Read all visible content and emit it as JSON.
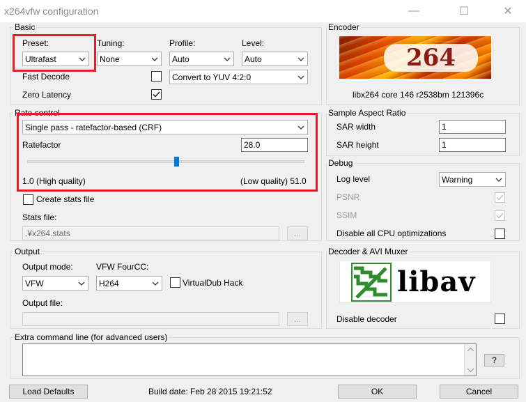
{
  "window": {
    "title": "x264vfw configuration",
    "minimize": "—",
    "maximize": "☐",
    "close": "✕"
  },
  "basic": {
    "group_label": "Basic",
    "preset_label": "Preset:",
    "preset_value": "Ultrafast",
    "tuning_label": "Tuning:",
    "tuning_value": "None",
    "profile_label": "Profile:",
    "profile_value": "Auto",
    "level_label": "Level:",
    "level_value": "Auto",
    "fast_decode_label": "Fast Decode",
    "fast_decode_checked": false,
    "colorspace_value": "Convert to YUV 4:2:0",
    "zero_latency_label": "Zero Latency",
    "zero_latency_checked": true
  },
  "encoder": {
    "group_label": "Encoder",
    "logo_text": "264",
    "version_text": "libx264 core 146 r2538bm 121396c"
  },
  "rate_control": {
    "group_label": "Rate control",
    "mode_value": "Single pass - ratefactor-based (CRF)",
    "ratefactor_label": "Ratefactor",
    "ratefactor_value": "28.0",
    "slider_position": 0.54,
    "min_label": "1.0 (High quality)",
    "max_label": "(Low quality) 51.0",
    "create_stats_label": "Create stats file",
    "create_stats_checked": false,
    "stats_file_label": "Stats file:",
    "stats_file_value": ".¥x264.stats",
    "browse_label": "..."
  },
  "sar": {
    "group_label": "Sample Aspect Ratio",
    "width_label": "SAR width",
    "width_value": "1",
    "height_label": "SAR height",
    "height_value": "1"
  },
  "debug": {
    "group_label": "Debug",
    "log_level_label": "Log level",
    "log_level_value": "Warning",
    "psnr_label": "PSNR",
    "ssim_label": "SSIM",
    "disable_cpu_label": "Disable all CPU optimizations"
  },
  "output": {
    "group_label": "Output",
    "mode_label": "Output mode:",
    "mode_value": "VFW",
    "fourcc_label": "VFW FourCC:",
    "fourcc_value": "H264",
    "virtualdub_label": "VirtualDub Hack",
    "file_label": "Output file:",
    "file_value": "",
    "browse_label": "..."
  },
  "decoder": {
    "group_label": "Decoder & AVI Muxer",
    "logo_text": "libav",
    "disable_decoder_label": "Disable decoder"
  },
  "extra": {
    "group_label": "Extra command line (for advanced users)",
    "value": "",
    "help_label": "?"
  },
  "footer": {
    "load_defaults_label": "Load Defaults",
    "build_date": "Build date: Feb 28 2015 19:21:52",
    "ok_label": "OK",
    "cancel_label": "Cancel"
  },
  "colors": {
    "highlight": "#e21f26",
    "slider": "#0078d7",
    "libav_green": "#2e8b2e"
  }
}
